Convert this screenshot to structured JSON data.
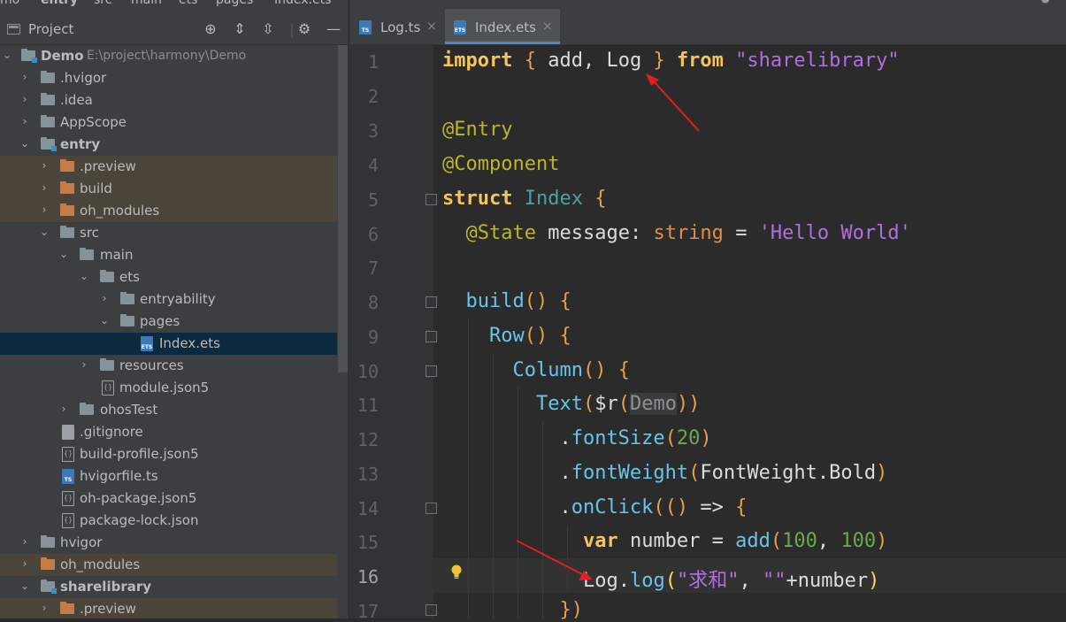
{
  "breadcrumb": {
    "items": [
      "mo",
      "entry",
      "src",
      "main",
      "ets",
      "pages",
      "Index.ets"
    ]
  },
  "project_panel": {
    "title": "Project",
    "tools": [
      "crosshair-icon",
      "expand-all-icon",
      "collapse-all-icon",
      "gear-icon",
      "minimize-icon"
    ],
    "tree": [
      {
        "label": "Demo",
        "path": "E:\\project\\harmony\\Demo"
      },
      {
        "label": ".hvigor"
      },
      {
        "label": ".idea"
      },
      {
        "label": "AppScope"
      },
      {
        "label": "entry"
      },
      {
        "label": ".preview"
      },
      {
        "label": "build"
      },
      {
        "label": "oh_modules"
      },
      {
        "label": "src"
      },
      {
        "label": "main"
      },
      {
        "label": "ets"
      },
      {
        "label": "entryability"
      },
      {
        "label": "pages"
      },
      {
        "label": "Index.ets"
      },
      {
        "label": "resources"
      },
      {
        "label": "module.json5"
      },
      {
        "label": "ohosTest"
      },
      {
        "label": ".gitignore"
      },
      {
        "label": "build-profile.json5"
      },
      {
        "label": "hvigorfile.ts"
      },
      {
        "label": "oh-package.json5"
      },
      {
        "label": "package-lock.json"
      },
      {
        "label": "hvigor"
      },
      {
        "label": "oh_modules"
      },
      {
        "label": "sharelibrary"
      },
      {
        "label": ".preview"
      }
    ]
  },
  "editor": {
    "tabs": [
      {
        "label": "Log.ts",
        "icon": "TS",
        "close": "×"
      },
      {
        "label": "Index.ets",
        "icon": "ETS",
        "close": "×"
      }
    ],
    "active_tab": "Index.ets",
    "line_numbers": [
      "1",
      "2",
      "3",
      "4",
      "5",
      "6",
      "7",
      "8",
      "9",
      "10",
      "11",
      "12",
      "13",
      "14",
      "15",
      "16",
      "17"
    ],
    "current_line": "16",
    "code": {
      "l1": {
        "import": "import",
        "ob": "{",
        "names": " add, Log ",
        "cb": "}",
        "from": "from",
        "src": "\"sharelibrary\""
      },
      "l3": "@Entry",
      "l4": "@Component",
      "l5": {
        "kw": "struct",
        "name": "Index",
        "b": "{"
      },
      "l6": {
        "ann": "@State",
        "id": "message",
        "colon": ":",
        "type": "string",
        "eq": "=",
        "val": "'Hello World'"
      },
      "l8": {
        "fn": "build",
        "p": "()",
        "b": "{"
      },
      "l9": {
        "fn": "Row",
        "p": "()",
        "b": "{"
      },
      "l10": {
        "fn": "Column",
        "p": "()",
        "b": "{"
      },
      "l11": {
        "fn": "Text",
        "p1": "(",
        "r": "$r",
        "p2": "(",
        "arg": "Demo",
        "p3": "))"
      },
      "l12": {
        "dot": ".",
        "fn": "fontSize",
        "p1": "(",
        "num": "20",
        "p2": ")"
      },
      "l13": {
        "dot": ".",
        "fn": "fontWeight",
        "p1": "(",
        "arg": "FontWeight.Bold",
        "p2": ")"
      },
      "l14": {
        "dot": ".",
        "fn": "onClick",
        "p1": "(()",
        "arrow": " => ",
        "b": "{"
      },
      "l15": {
        "kw": "var",
        "id": " number ",
        "eq": "=",
        "fn": " add",
        "p1": "(",
        "n1": "100",
        "comma": ", ",
        "n2": "100",
        "p2": ")"
      },
      "l16": {
        "obj": "Log",
        "dot": ".",
        "fn": "log",
        "p1": "(",
        "s1": "\"求和\"",
        "comma": ", ",
        "s2": "\"\"",
        "plus": "+number",
        "p2": ")"
      },
      "l17": "})"
    }
  },
  "colors": {
    "accent": "#4a88c7",
    "arrow": "#e02020",
    "selection": "#0d293e"
  }
}
